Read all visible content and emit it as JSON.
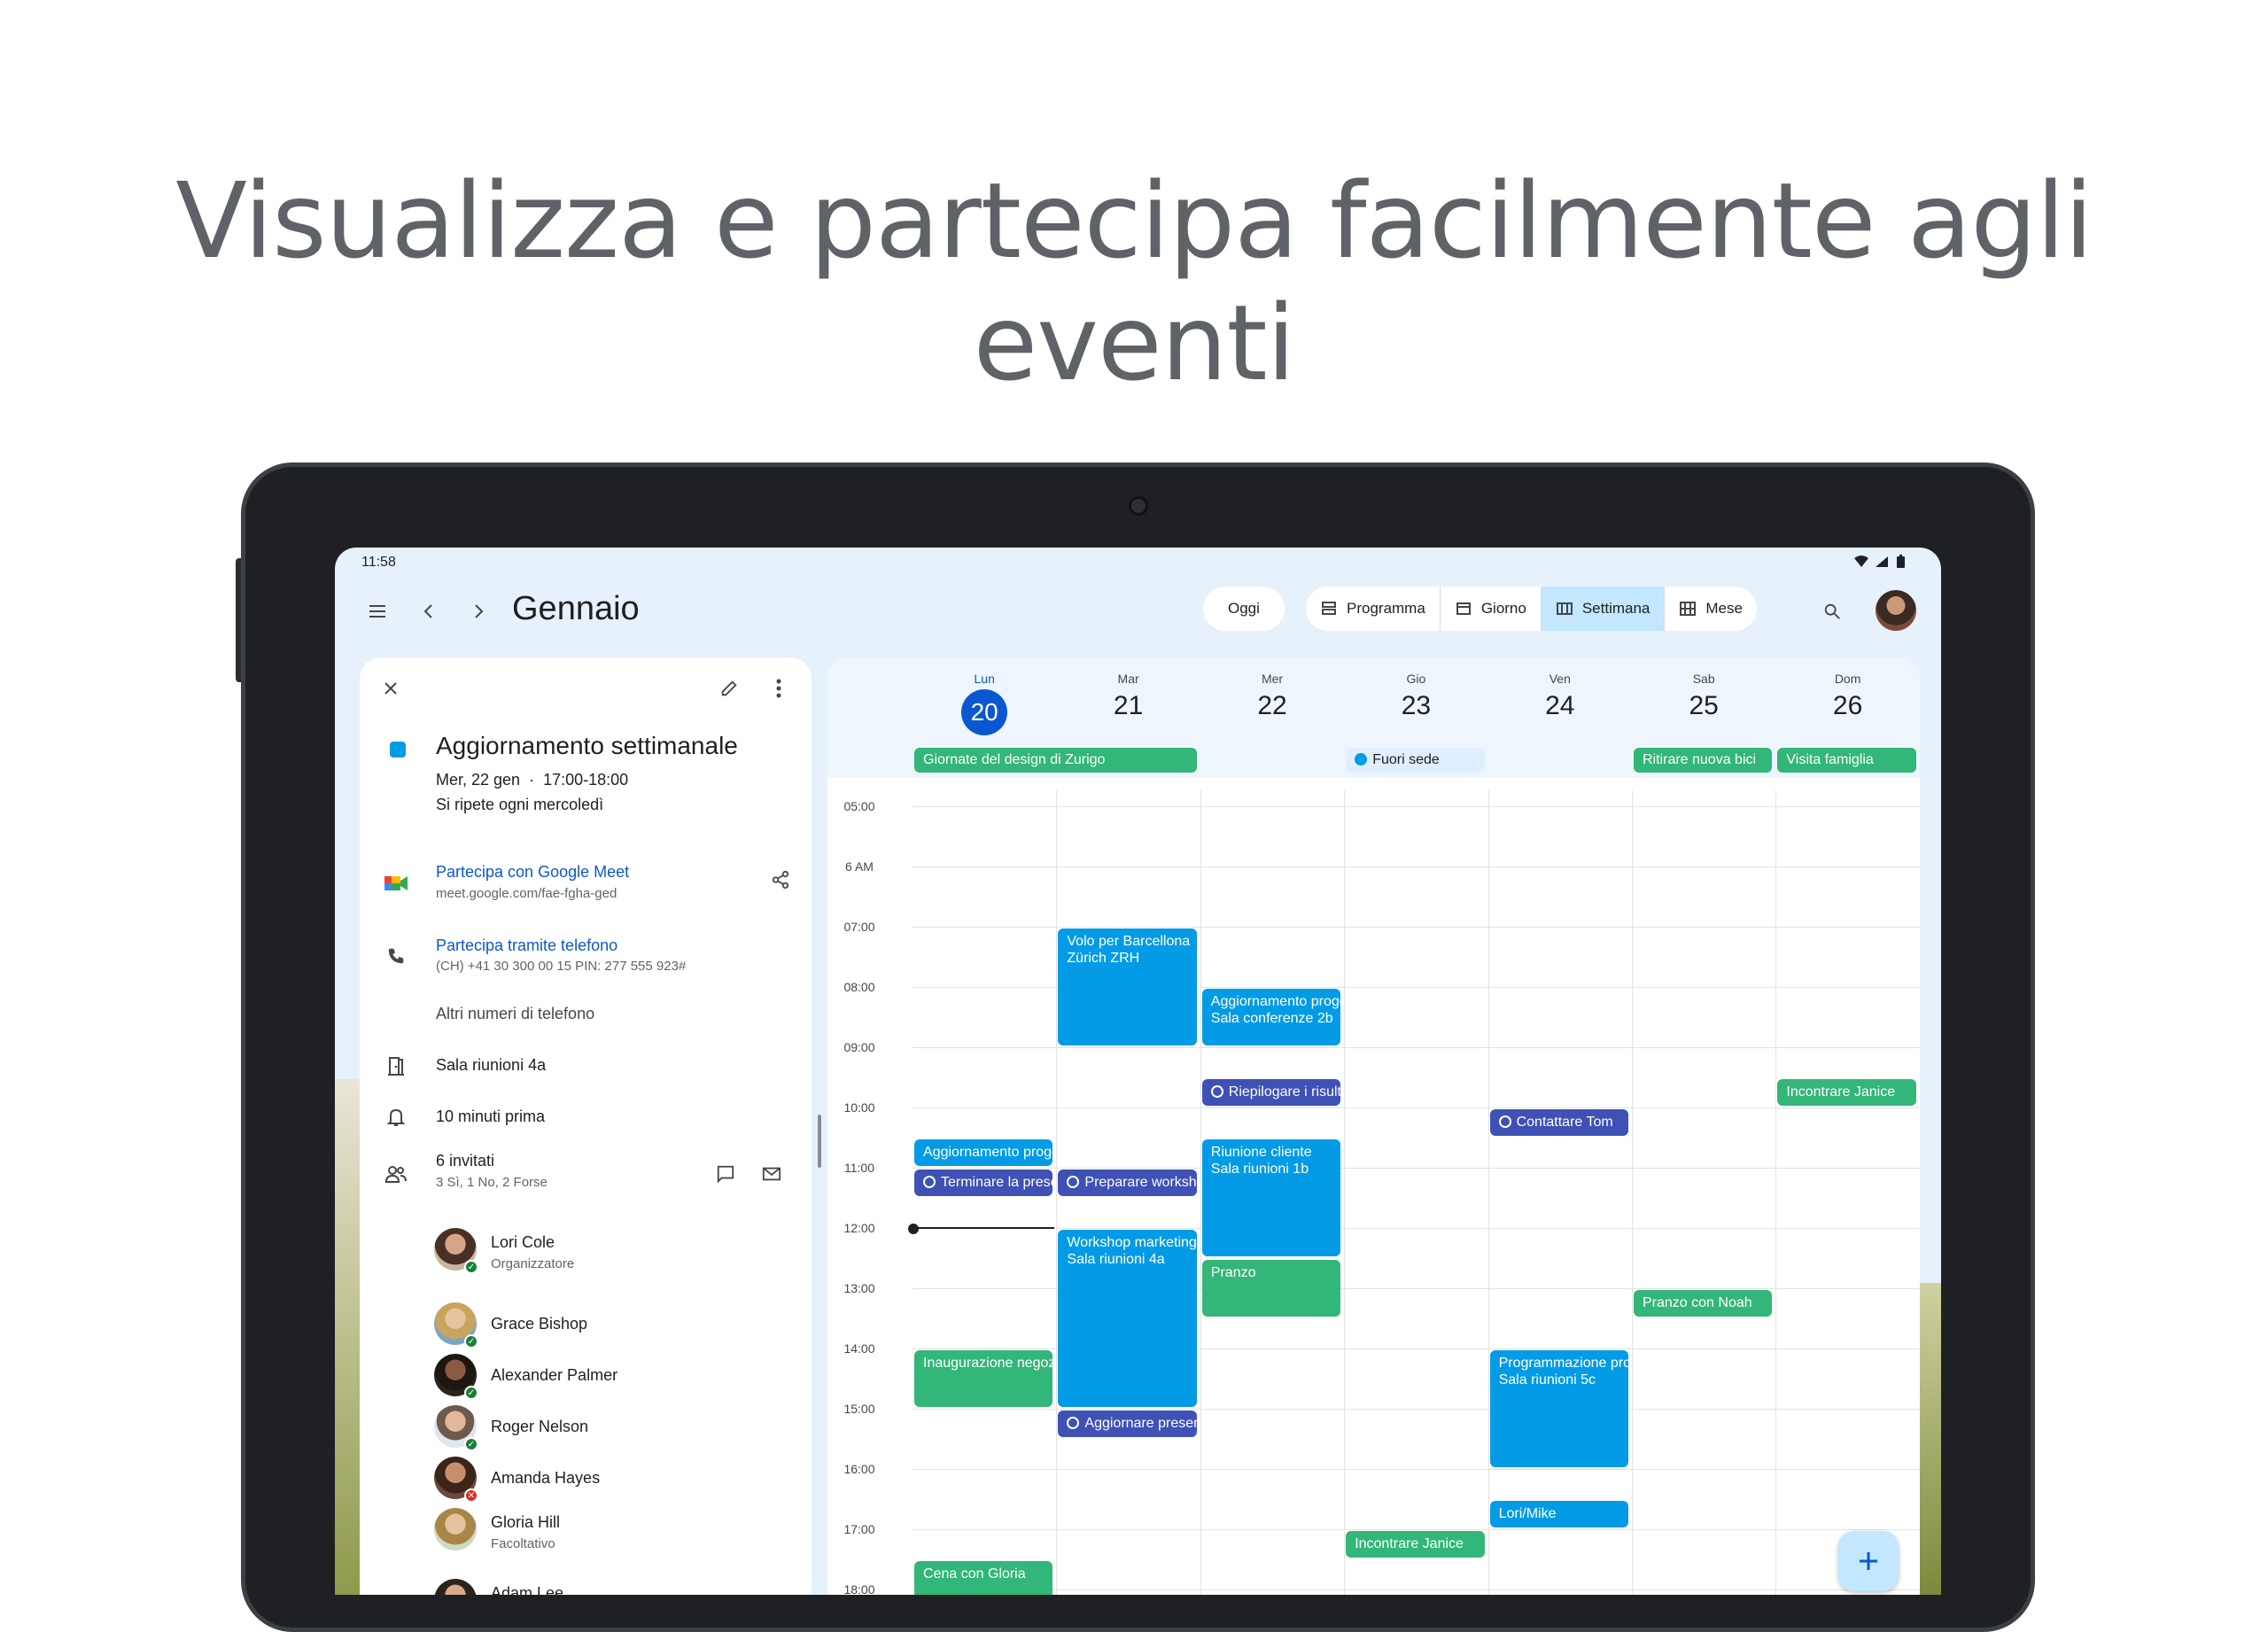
{
  "headline": "Visualizza e partecipa facilmente agli eventi",
  "status": {
    "time": "11:58"
  },
  "topbar": {
    "month": "Gennaio",
    "today_label": "Oggi",
    "views": [
      "Programma",
      "Giorno",
      "Settimana",
      "Mese"
    ],
    "active_view": "Settimana"
  },
  "event": {
    "title": "Aggiornamento settimanale",
    "date": "Mer, 22 gen",
    "time": "17:00-18:00",
    "recurrence": "Si ripete ogni mercoledì",
    "color": "#039be5",
    "meet_link": "Partecipa con Google Meet",
    "meet_url": "meet.google.com/fae-fgha-ged",
    "phone_link": "Partecipa tramite telefono",
    "phone_number": "(CH) +41 30 300 00 15 PIN: 277 555 923#",
    "more_numbers": "Altri numeri di telefono",
    "room": "Sala riunioni 4a",
    "reminder": "10 minuti prima",
    "guests_count": "6 invitati",
    "guests_summary": "3 Sì, 1 No, 2 Forse",
    "guests": [
      {
        "name": "Lori Cole",
        "role": "Organizzatore",
        "rsvp": "yes"
      },
      {
        "name": "Grace Bishop",
        "role": "",
        "rsvp": "yes"
      },
      {
        "name": "Alexander Palmer",
        "role": "",
        "rsvp": "yes"
      },
      {
        "name": "Roger Nelson",
        "role": "",
        "rsvp": "yes"
      },
      {
        "name": "Amanda Hayes",
        "role": "",
        "rsvp": "no"
      },
      {
        "name": "Gloria Hill",
        "role": "Facoltativo",
        "rsvp": "maybe"
      },
      {
        "name": "Adam Lee",
        "role": "",
        "rsvp": ""
      }
    ]
  },
  "calendar": {
    "days": [
      {
        "name": "Lun",
        "num": "20",
        "today": true
      },
      {
        "name": "Mar",
        "num": "21"
      },
      {
        "name": "Mer",
        "num": "22"
      },
      {
        "name": "Gio",
        "num": "23"
      },
      {
        "name": "Ven",
        "num": "24"
      },
      {
        "name": "Sab",
        "num": "25"
      },
      {
        "name": "Dom",
        "num": "26"
      }
    ],
    "hours": [
      "05:00",
      "6 AM",
      "07:00",
      "08:00",
      "09:00",
      "10:00",
      "11:00",
      "12:00",
      "13:00",
      "14:00",
      "15:00",
      "16:00",
      "17:00",
      "18:00"
    ],
    "all_day": [
      {
        "day": 0,
        "span": 2,
        "title": "Giornate del design di Zurigo",
        "color": "green"
      },
      {
        "day": 3,
        "span": 1,
        "title": "Fuori sede",
        "color": "pale"
      },
      {
        "day": 5,
        "span": 1,
        "title": "Ritirare nuova bici",
        "color": "green"
      },
      {
        "day": 6,
        "span": 1,
        "title": "Visita famiglia",
        "color": "green"
      }
    ],
    "events": [
      {
        "day": 1,
        "start": 7.0,
        "end": 9.0,
        "title": "Volo per Barcellona",
        "sub": "Zürich ZRH",
        "color": "blue"
      },
      {
        "day": 2,
        "start": 8.0,
        "end": 9.0,
        "title": "Aggiornamento progetto",
        "sub": "Sala conferenze 2b",
        "color": "blue"
      },
      {
        "day": 2,
        "start": 9.5,
        "end": 10.0,
        "title": "Riepilogare i risultati",
        "sub": "",
        "color": "indigo",
        "task": true
      },
      {
        "day": 6,
        "start": 9.5,
        "end": 10.0,
        "title": "Incontrare Janice",
        "sub": "",
        "color": "green"
      },
      {
        "day": 4,
        "start": 10.0,
        "end": 10.5,
        "title": "Contattare Tom",
        "sub": "",
        "color": "indigo",
        "task": true
      },
      {
        "day": 0,
        "start": 10.5,
        "end": 11.0,
        "title": "Aggiornamento progetto",
        "sub": "",
        "color": "blue"
      },
      {
        "day": 0,
        "start": 11.0,
        "end": 11.5,
        "title": "Terminare la presentazione",
        "sub": "",
        "color": "indigo",
        "task": true
      },
      {
        "day": 1,
        "start": 11.0,
        "end": 11.5,
        "title": "Preparare workshop",
        "sub": "",
        "color": "indigo",
        "task": true
      },
      {
        "day": 2,
        "start": 10.5,
        "end": 12.5,
        "title": "Riunione cliente",
        "sub": "Sala riunioni 1b",
        "color": "blue"
      },
      {
        "day": 1,
        "start": 12.0,
        "end": 15.0,
        "title": "Workshop marketing",
        "sub": "Sala riunioni 4a",
        "color": "blue"
      },
      {
        "day": 2,
        "start": 12.5,
        "end": 13.5,
        "title": "Pranzo",
        "sub": "",
        "color": "green"
      },
      {
        "day": 5,
        "start": 13.0,
        "end": 13.5,
        "title": "Pranzo con Noah",
        "sub": "",
        "color": "green"
      },
      {
        "day": 0,
        "start": 14.0,
        "end": 15.0,
        "title": "Inaugurazione negozio",
        "sub": "",
        "color": "green"
      },
      {
        "day": 4,
        "start": 14.0,
        "end": 16.0,
        "title": "Programmazione progetto",
        "sub": "Sala riunioni 5c",
        "color": "blue"
      },
      {
        "day": 1,
        "start": 15.0,
        "end": 15.5,
        "title": "Aggiornare presentazione",
        "sub": "",
        "color": "indigo",
        "task": true
      },
      {
        "day": 4,
        "start": 16.5,
        "end": 17.0,
        "title": "Lori/Mike",
        "sub": "",
        "color": "blue"
      },
      {
        "day": 3,
        "start": 17.0,
        "end": 17.5,
        "title": "Incontrare Janice",
        "sub": "",
        "color": "green"
      },
      {
        "day": 0,
        "start": 17.5,
        "end": 18.5,
        "title": "Cena con Gloria",
        "sub": "",
        "color": "green"
      }
    ]
  },
  "colors": {
    "green": "#33b679",
    "blue": "#039be5",
    "indigo": "#3f51b5",
    "accent": "#0b57d0"
  }
}
